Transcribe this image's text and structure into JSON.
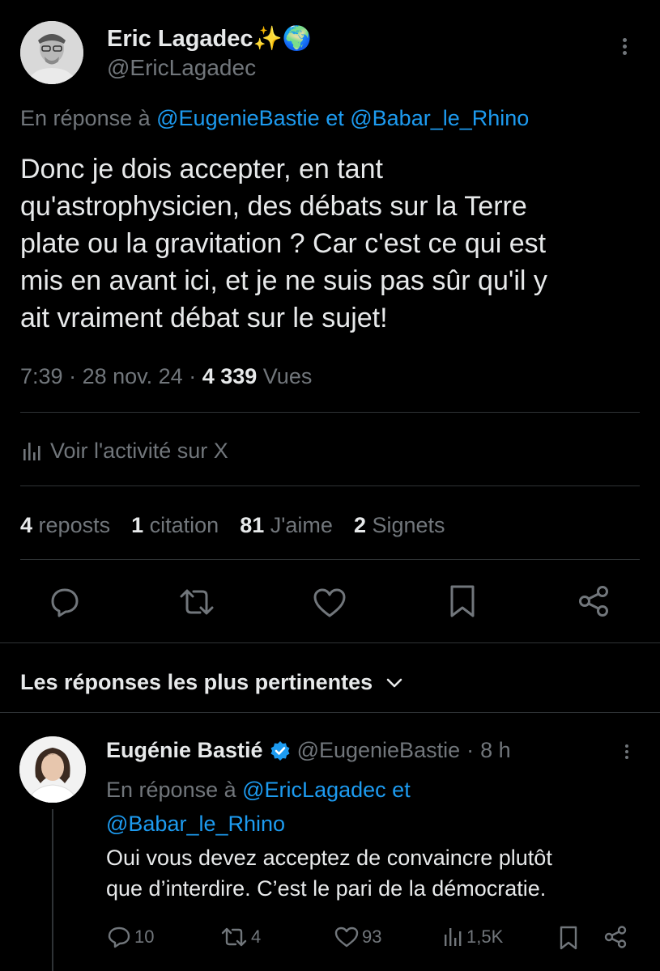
{
  "main_tweet": {
    "author_name": "Eric Lagadec",
    "author_emoji": "✨🌍",
    "author_handle": "@EricLagadec",
    "reply_prefix": "En réponse à",
    "reply_to_1": "@EugenieBastie",
    "reply_joiner": "et",
    "reply_to_2": "@Babar_le_Rhino",
    "text_lines": [
      "Donc je dois accepter, en tant",
      "qu'astrophysicien, des débats sur la Terre",
      "plate ou la gravitation ? Car c'est ce qui est",
      "mis en avant ici,  et  je ne suis pas sûr qu'il y",
      "ait vraiment débat sur le sujet!"
    ],
    "time": "7:39",
    "date": "28 nov. 24",
    "views_count": "4 339",
    "views_label": "Vues",
    "activity_label": "Voir l'activité sur X",
    "stats": {
      "reposts_count": "4",
      "reposts_label": "reposts",
      "quotes_count": "1",
      "quotes_label": "citation",
      "likes_count": "81",
      "likes_label": "J'aime",
      "bookmarks_count": "2",
      "bookmarks_label": "Signets"
    },
    "actions": [
      "reply-icon",
      "repost-icon",
      "like-icon",
      "bookmark-icon",
      "share-icon"
    ]
  },
  "replies_header": "Les réponses les plus pertinentes",
  "reply": {
    "author_name": "Eugénie Bastié",
    "author_handle": "@EugenieBastie",
    "separator": "·",
    "age": "8 h",
    "reply_prefix": "En réponse à",
    "reply_to_1": "@EricLagadec",
    "reply_joiner": "et",
    "reply_to_2": "@Babar_le_Rhino",
    "text_lines": [
      "Oui vous devez acceptez de convaincre plutôt",
      "que d’interdire. C’est le pari de la démocratie."
    ],
    "actions": {
      "replies": "10",
      "reposts": "4",
      "likes": "93",
      "views": "1,5K"
    }
  },
  "colors": {
    "background": "#000000",
    "text": "#e7e9ea",
    "muted": "#71767b",
    "link": "#1d9bf0",
    "divider": "#2f3336",
    "verified": "#1d9bf0"
  }
}
